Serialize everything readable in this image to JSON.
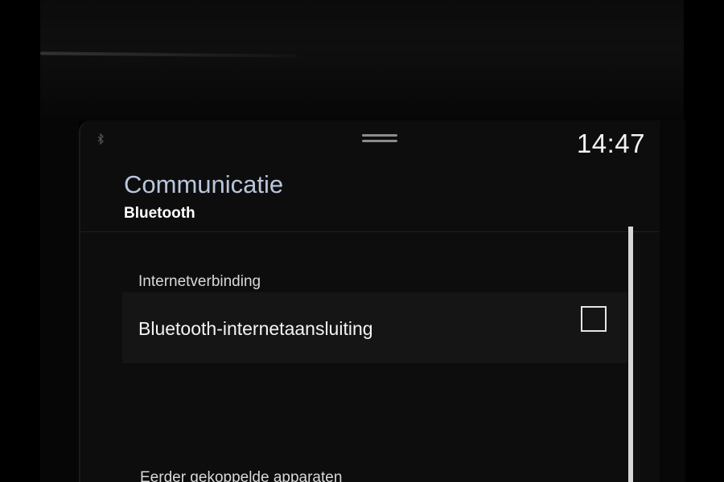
{
  "status_bar": {
    "bluetooth_icon": "bluetooth-icon",
    "time": "14:47"
  },
  "header": {
    "title": "Communicatie",
    "subtitle": "Bluetooth"
  },
  "sections": [
    {
      "heading": "Internetverbinding",
      "items": [
        {
          "label": "Bluetooth-internetaansluiting",
          "control": "checkbox",
          "checked": false
        }
      ]
    },
    {
      "heading": "Eerder gekoppelde apparaten"
    }
  ],
  "colors": {
    "title": "#b9c6dc",
    "background": "#0d0d0d",
    "row_background": "#151515"
  }
}
